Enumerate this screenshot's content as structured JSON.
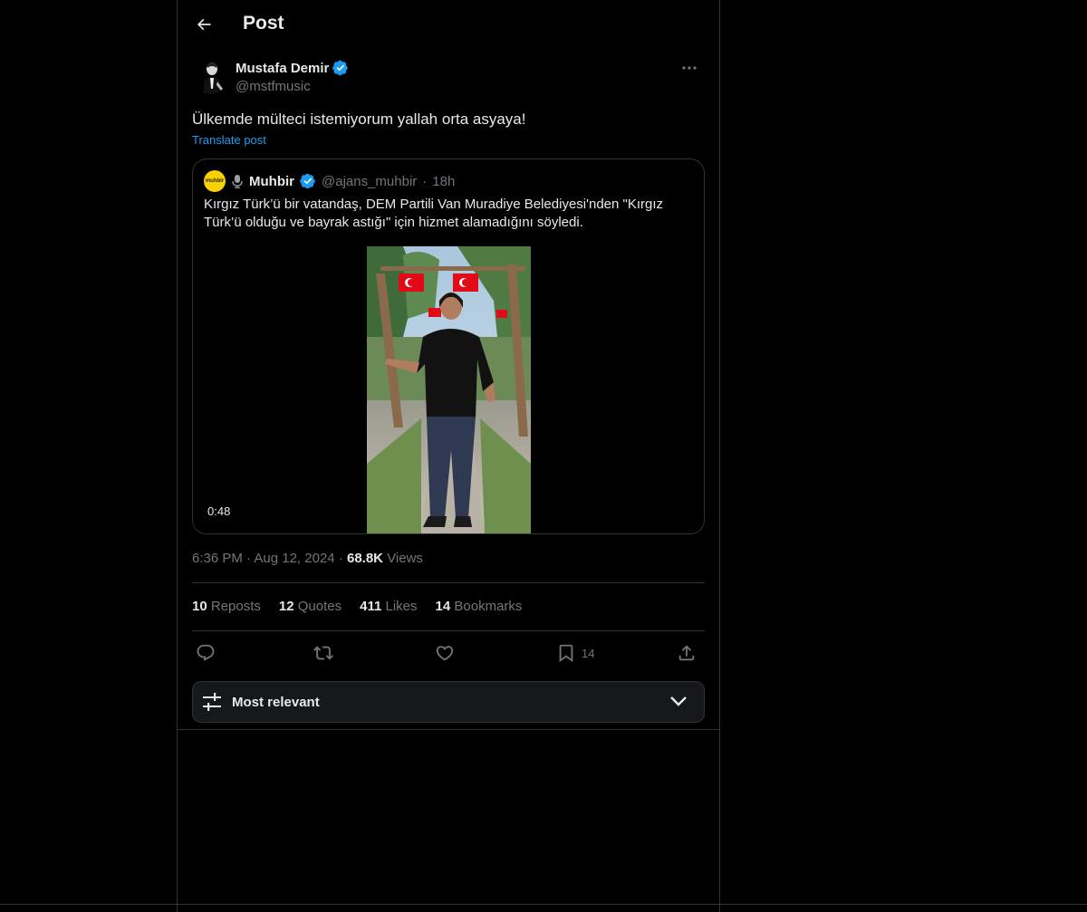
{
  "header": {
    "title": "Post"
  },
  "post": {
    "author_name": "Mustafa Demir",
    "author_handle": "@mstfmusic",
    "text": "Ülkemde mülteci istemiyorum yallah orta asyaya!",
    "translate": "Translate post",
    "time": "6:36 PM",
    "date": "Aug 12, 2024",
    "views_count": "68.8K",
    "views_label": "Views"
  },
  "quote": {
    "avatar_text": "muhbir",
    "name": "Muhbir",
    "handle": "@ajans_muhbir",
    "time": "18h",
    "text": "Kırgız Türk’ü bir vatandaş, DEM Partili Van Muradiye Belediyesi'nden \"Kırgız Türk’ü olduğu ve bayrak astığı\" için hizmet alamadığını söyledi.",
    "duration": "0:48"
  },
  "stats": {
    "reposts_count": "10",
    "reposts_label": "Reposts",
    "quotes_count": "12",
    "quotes_label": "Quotes",
    "likes_count": "411",
    "likes_label": "Likes",
    "bookmarks_count": "14",
    "bookmarks_label": "Bookmarks"
  },
  "actions": {
    "bookmark_count": "14"
  },
  "sort": {
    "label": "Most relevant"
  },
  "colors": {
    "accent": "#1d9bf0",
    "verified": "#1d9bf0",
    "muted": "#71767b",
    "border": "#2f3336"
  }
}
